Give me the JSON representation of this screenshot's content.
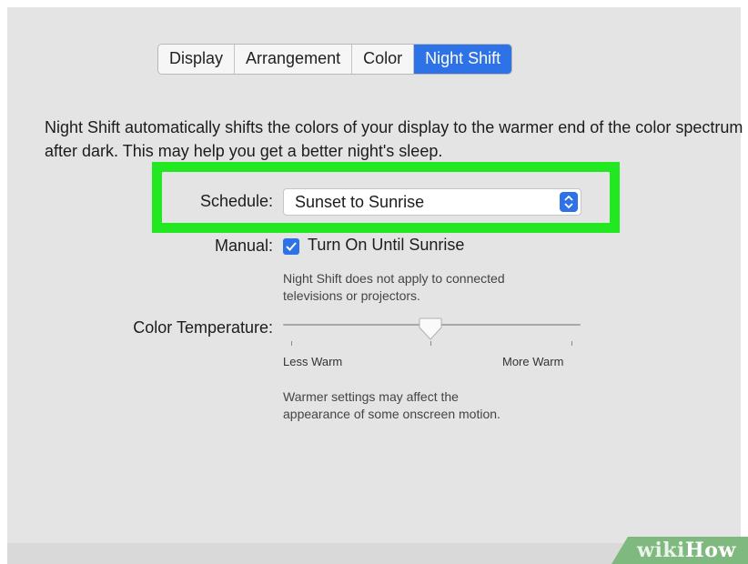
{
  "tabs": [
    {
      "label": "Display",
      "active": false
    },
    {
      "label": "Arrangement",
      "active": false
    },
    {
      "label": "Color",
      "active": false
    },
    {
      "label": "Night Shift",
      "active": true
    }
  ],
  "description": "Night Shift automatically shifts the colors of your display to the warmer end of the color spectrum after dark. This may help you get a better night's sleep.",
  "schedule": {
    "label": "Schedule:",
    "value": "Sunset to Sunrise",
    "highlight_color": "#22e822"
  },
  "manual": {
    "label": "Manual:",
    "checked": true,
    "option_label": "Turn On Until Sunrise",
    "note_line1": "Night Shift does not apply to connected",
    "note_line2": "televisions or projectors."
  },
  "color_temperature": {
    "label": "Color Temperature:",
    "min_label": "Less Warm",
    "max_label": "More Warm",
    "value_fraction": 0.5,
    "note_line1": "Warmer settings may affect the",
    "note_line2": "appearance of some onscreen motion."
  },
  "colors": {
    "accent": "#2e72e8",
    "panel": "#e4e4e4"
  },
  "watermark": {
    "text_wiki": "wiki",
    "text_how": "How"
  }
}
